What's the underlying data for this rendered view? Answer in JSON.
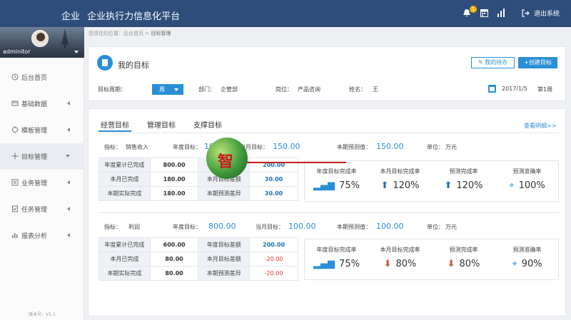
{
  "header": {
    "brand_prefix": "企业",
    "brand_title": "企业执行力信息化平台",
    "notification_count": "1",
    "logout_label": "退出系统"
  },
  "sidebar": {
    "username": "adminitor",
    "items": [
      {
        "label": "后台首页",
        "icon": "home-icon"
      },
      {
        "label": "基础数据",
        "icon": "database-icon"
      },
      {
        "label": "模板管理",
        "icon": "template-icon"
      },
      {
        "label": "目标管理",
        "icon": "target-icon"
      },
      {
        "label": "业务管理",
        "icon": "business-icon"
      },
      {
        "label": "任务管理",
        "icon": "task-icon"
      },
      {
        "label": "报表分析",
        "icon": "chart-icon"
      }
    ],
    "version": "版本号：V1.1"
  },
  "breadcrumb": {
    "prefix": "您现在的位置：",
    "home": "后台首页",
    "separator": ">",
    "current": "目标管理"
  },
  "goal_card": {
    "title": "我的目标",
    "todo_button": "我的待办",
    "create_button": "+创建目标",
    "filters": {
      "period_label": "目标周期：",
      "period_value": "周",
      "dept_label": "部门：",
      "dept_value": "企管部",
      "post_label": "岗位：",
      "post_value": "产品咨询",
      "name_label": "姓名：",
      "name_value": "王",
      "date": "2017/1/5",
      "week": "第1周"
    }
  },
  "main": {
    "tabs": [
      {
        "label": "经营目标",
        "active": true
      },
      {
        "label": "管理目标",
        "active": false
      },
      {
        "label": "支撑目标",
        "active": false
      }
    ],
    "detail_link": "查看明细>>",
    "sections": [
      {
        "indicator_label": "指标：",
        "indicator_value": "销售收入",
        "annual_label": "年度目标：",
        "annual_value": "10",
        "month_label": "当月目标：",
        "month_value": "150.00",
        "forecast_label": "本期预测值：",
        "forecast_value": "150.00",
        "unit_label": "单位：",
        "unit_value": "万元",
        "rows": [
          {
            "l1": "年度累计已完成",
            "v1": "800.00",
            "l2": "年度目标差额",
            "v2": "200.00"
          },
          {
            "l1": "本月已完成",
            "v1": "180.00",
            "l2": "本月目标差额",
            "v2": "30.00"
          },
          {
            "l1": "本期实际完成",
            "v1": "180.00",
            "l2": "本期预测差异",
            "v2": "30.00"
          }
        ],
        "kpis": [
          {
            "label": "年度目标完成率",
            "value": "75%",
            "trend": "bars"
          },
          {
            "label": "本月目标完成率",
            "value": "120%",
            "trend": "up"
          },
          {
            "label": "预测完成率",
            "value": "120%",
            "trend": "up"
          },
          {
            "label": "预测准确率",
            "value": "100%",
            "trend": "crosshair"
          }
        ]
      },
      {
        "indicator_label": "指标：",
        "indicator_value": "利润",
        "annual_label": "年度目标：",
        "annual_value": "800.00",
        "month_label": "当月目标：",
        "month_value": "100.00",
        "forecast_label": "本期预测值：",
        "forecast_value": "100.00",
        "unit_label": "单位：",
        "unit_value": "万元",
        "rows": [
          {
            "l1": "年度累计已完成",
            "v1": "600.00",
            "l2": "年度目标差额",
            "v2": "200.00"
          },
          {
            "l1": "本月已完成",
            "v1": "80.00",
            "l2": "本月目标差额",
            "v2": "-20.00"
          },
          {
            "l1": "本期实际完成",
            "v1": "80.00",
            "l2": "本期预测差异",
            "v2": "-20.00"
          }
        ],
        "kpis": [
          {
            "label": "年度目标完成率",
            "value": "75%",
            "trend": "bars"
          },
          {
            "label": "本月目标完成率",
            "value": "80%",
            "trend": "down"
          },
          {
            "label": "预测完成率",
            "value": "80%",
            "trend": "down"
          },
          {
            "label": "预测准确率",
            "value": "90%",
            "trend": "crosshair"
          }
        ]
      }
    ]
  },
  "watermark": {
    "char": "智"
  },
  "colors": {
    "header": "#2e4d7b",
    "accent": "#2a8fd6",
    "negative": "#d9382a"
  }
}
